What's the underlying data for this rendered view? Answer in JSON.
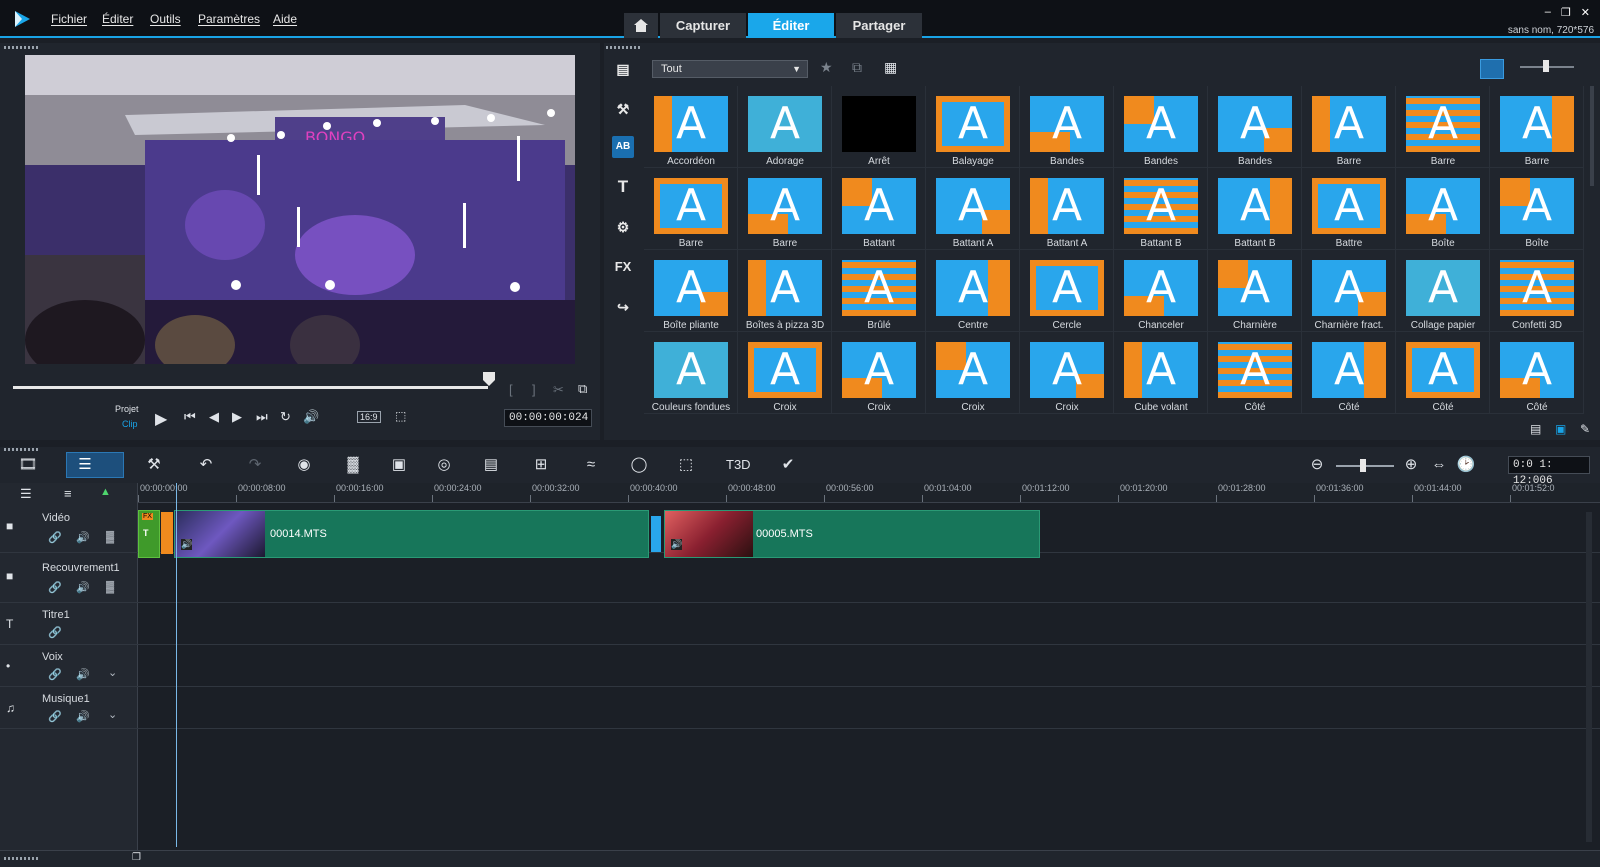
{
  "menu": {
    "items": [
      "Fichier",
      "Éditer",
      "Outils",
      "Paramètres",
      "Aide"
    ]
  },
  "tabs": {
    "home_icon": "home-icon",
    "items": [
      {
        "label": "Capturer",
        "active": false
      },
      {
        "label": "Éditer",
        "active": true
      },
      {
        "label": "Partager",
        "active": false
      }
    ]
  },
  "project_info": "sans nom, 720*576",
  "player": {
    "mode_project": "Projet",
    "mode_clip": "Clip",
    "aspect": "16:9",
    "timecode": "00:00:00:024",
    "progress_fraction": 0.97
  },
  "library": {
    "filter_value": "Tout",
    "transitions": [
      "Accordéon",
      "Adorage",
      "Arrêt",
      "Balayage",
      "Bandes",
      "Bandes",
      "Bandes",
      "Barre",
      "Barre",
      "Barre",
      "Barre",
      "Barre",
      "Battant",
      "Battant A",
      "Battant A",
      "Battant B",
      "Battant B",
      "Battre",
      "Boîte",
      "Boîte",
      "Boîte pliante",
      "Boîtes à pizza 3D",
      "Brûlé",
      "Centre",
      "Cercle",
      "Chanceler",
      "Charnière",
      "Charnière fract.",
      "Collage papier",
      "Confetti 3D",
      "Couleurs fondues",
      "Croix",
      "Croix",
      "Croix",
      "Croix",
      "Cube volant",
      "Côté",
      "Côté",
      "Côté",
      "Côté"
    ],
    "side_tabs": [
      "media-icon",
      "instant-project-icon",
      "transition-icon",
      "title-icon",
      "graphics-icon",
      "FX",
      "motion-path-icon"
    ]
  },
  "timeline": {
    "ruler": [
      "00:00:00:00",
      "00:00:08:00",
      "00:00:16:00",
      "00:00:24:00",
      "00:00:32:00",
      "00:00:40:00",
      "00:00:48:00",
      "00:00:56:00",
      "00:01:04:00",
      "00:01:12:00",
      "00:01:20:00",
      "00:01:28:00",
      "00:01:36:00",
      "00:01:44:00",
      "00:01:52:0"
    ],
    "duration": "0:0 1: 12:006",
    "tracks": [
      {
        "name": "Vidéo"
      },
      {
        "name": "Recouvrement1"
      },
      {
        "name": "Titre1"
      },
      {
        "name": "Voix"
      },
      {
        "name": "Musique1"
      }
    ],
    "clips": [
      {
        "name": "00014.MTS"
      },
      {
        "name": "00005.MTS"
      }
    ],
    "fx_badge": "FX",
    "title_badge": "T"
  },
  "colors": {
    "accent": "#19a3e6",
    "clip": "#17765a",
    "thumb_blue": "#29a6ec",
    "thumb_orange": "#f08a1e"
  }
}
